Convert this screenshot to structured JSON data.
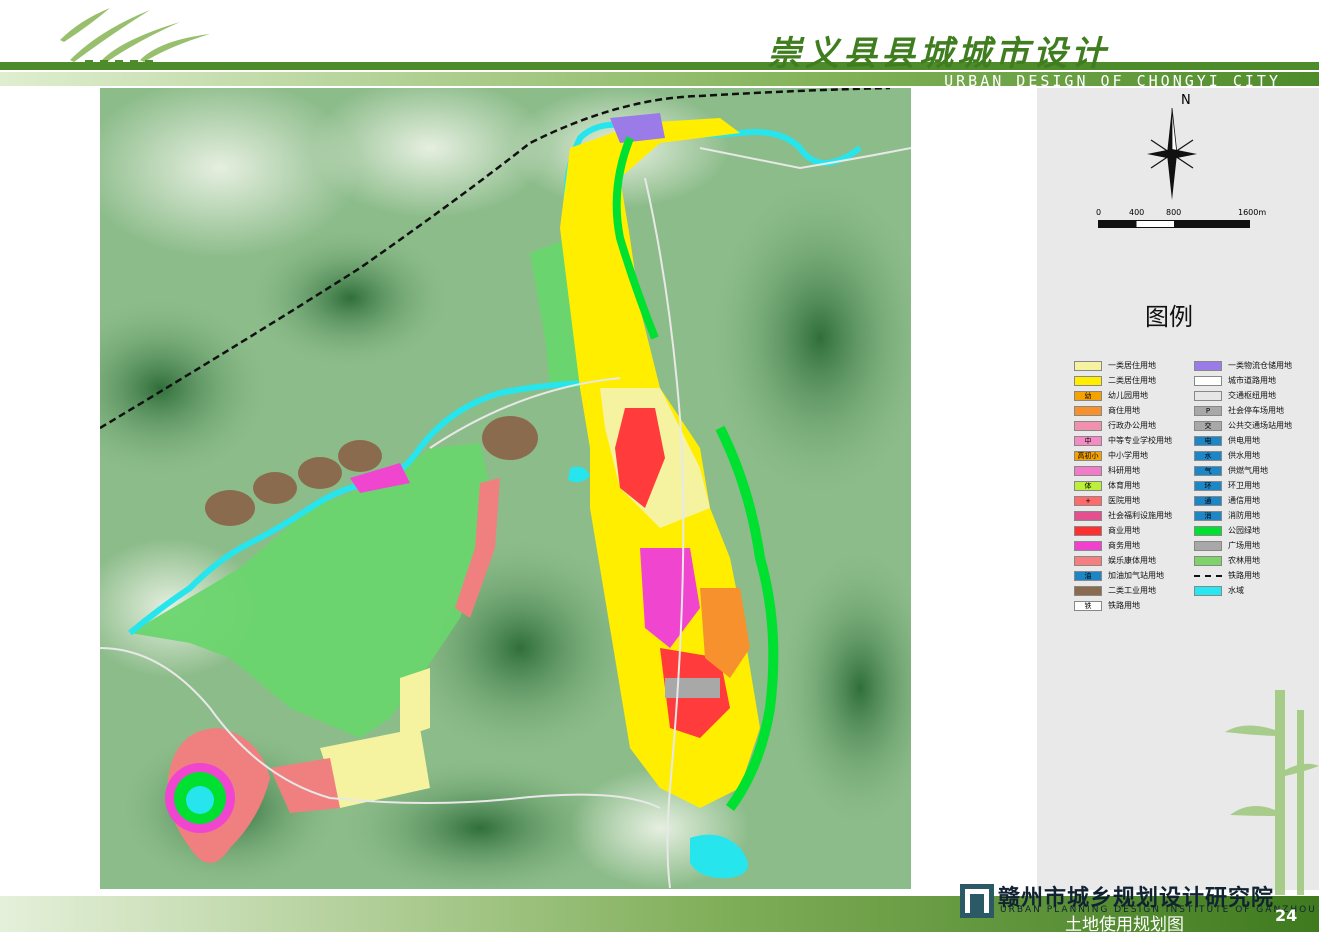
{
  "header": {
    "title_cn": "崇义县县城城市设计",
    "title_en": "URBAN DESIGN OF CHONGYI CITY"
  },
  "map": {
    "north_label": "N",
    "scale_labels": [
      "0",
      "400",
      "800",
      "1600m"
    ],
    "colors": {
      "terrain_low": "#c7ddb9",
      "terrain_high": "#3d7a45",
      "water": "#27e5ec",
      "park": "#63d66a",
      "residential1": "#f6f39a",
      "residential2": "#ffee00",
      "commercial": "#ff3b3b",
      "business": "#f046cf",
      "industrial": "#8b6b4e",
      "recreation": "#f08080",
      "railway": "#111111"
    }
  },
  "legend": {
    "title": "图例",
    "left_items": [
      {
        "label": "一类居住用地",
        "color": "#f6f3a0",
        "icon": ""
      },
      {
        "label": "二类居住用地",
        "color": "#ffee00",
        "icon": ""
      },
      {
        "label": "幼儿园用地",
        "color": "#f5a100",
        "icon": "幼"
      },
      {
        "label": "商住用地",
        "color": "#f7912e",
        "icon": ""
      },
      {
        "label": "行政办公用地",
        "color": "#f290b0",
        "icon": ""
      },
      {
        "label": "中等专业学校用地",
        "color": "#f58ac4",
        "icon": "中"
      },
      {
        "label": "中小学用地",
        "color": "#f5a100",
        "icon": "高初小"
      },
      {
        "label": "科研用地",
        "color": "#f07bc8",
        "icon": ""
      },
      {
        "label": "体育用地",
        "color": "#bdf03a",
        "icon": "体"
      },
      {
        "label": "医院用地",
        "color": "#ff6b6b",
        "icon": "+"
      },
      {
        "label": "社会福利设施用地",
        "color": "#e2508f",
        "icon": ""
      },
      {
        "label": "商业用地",
        "color": "#ff3030",
        "icon": ""
      },
      {
        "label": "商务用地",
        "color": "#f040d0",
        "icon": ""
      },
      {
        "label": "娱乐康体用地",
        "color": "#f57e7e",
        "icon": ""
      },
      {
        "label": "加油加气站用地",
        "color": "#1c86c6",
        "icon": "油"
      },
      {
        "label": "二类工业用地",
        "color": "#8b6b4e",
        "icon": ""
      },
      {
        "label": "铁路用地",
        "color": "#ffffff",
        "icon": "铁"
      }
    ],
    "right_items": [
      {
        "label": "一类物流仓储用地",
        "color": "#9b7be8",
        "icon": ""
      },
      {
        "label": "城市道路用地",
        "color": "#ffffff",
        "icon": ""
      },
      {
        "label": "交通枢纽用地",
        "color": "#e6e6e6",
        "icon": ""
      },
      {
        "label": "社会停车场用地",
        "color": "#a8a8a8",
        "icon": "P"
      },
      {
        "label": "公共交通场站用地",
        "color": "#a8a8a8",
        "icon": "交"
      },
      {
        "label": "供电用地",
        "color": "#1c86c6",
        "icon": "电"
      },
      {
        "label": "供水用地",
        "color": "#1c86c6",
        "icon": "水"
      },
      {
        "label": "供燃气用地",
        "color": "#1c86c6",
        "icon": "气"
      },
      {
        "label": "环卫用地",
        "color": "#1c86c6",
        "icon": "环"
      },
      {
        "label": "通信用地",
        "color": "#1c86c6",
        "icon": "通"
      },
      {
        "label": "消防用地",
        "color": "#1c86c6",
        "icon": "消"
      },
      {
        "label": "公园绿地",
        "color": "#00e030",
        "icon": ""
      },
      {
        "label": "广场用地",
        "color": "#a8a8a8",
        "icon": ""
      },
      {
        "label": "农林用地",
        "color": "#7ed36a",
        "icon": ""
      },
      {
        "label": "铁路用地",
        "color": "dash",
        "icon": ""
      },
      {
        "label": "水域",
        "color": "#2ae6f0",
        "icon": ""
      }
    ]
  },
  "footer": {
    "institute_cn": "赣州市城乡规划设计研究院",
    "institute_en": "URBAN PLANNING DESIGN INSTITUTE OF GANZHOU",
    "drawing_title": "土地使用规划图",
    "page": "24"
  }
}
